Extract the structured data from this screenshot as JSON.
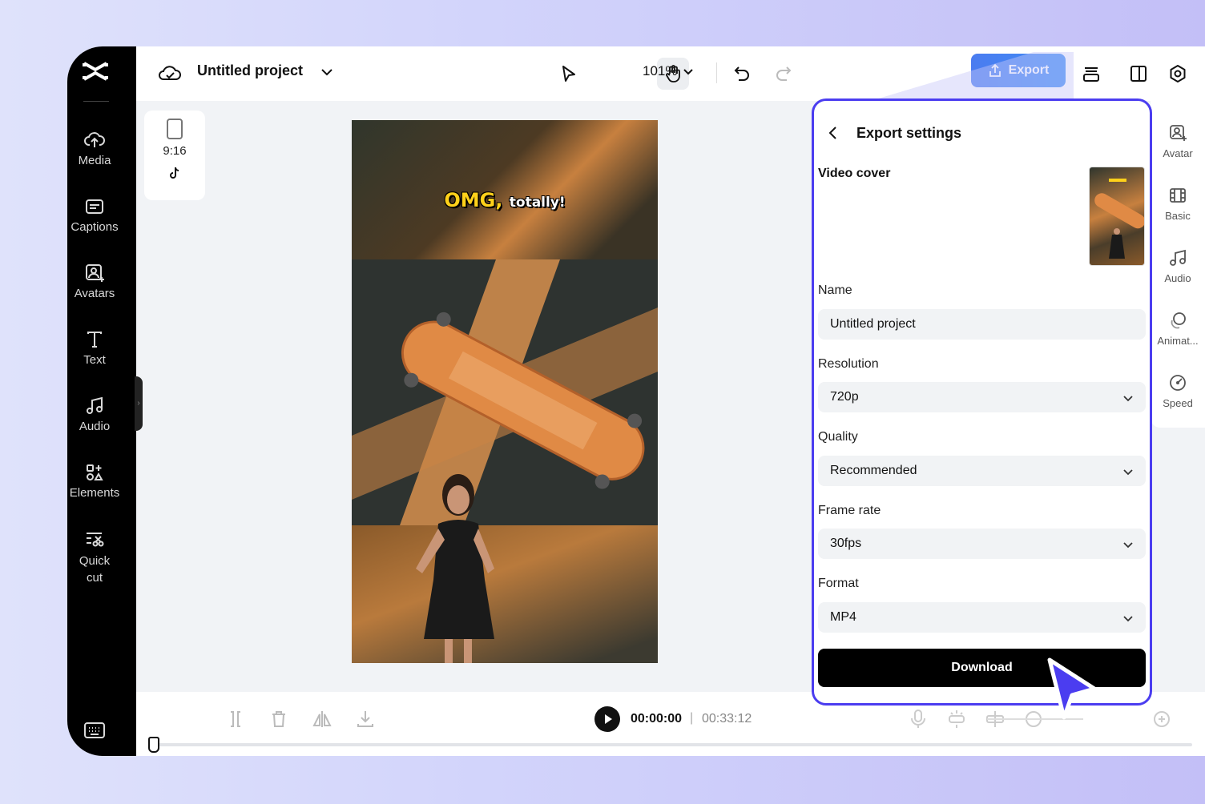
{
  "header": {
    "project_title": "Untitled project",
    "zoom": "101%",
    "export_label": "Export"
  },
  "sidebar": {
    "items": [
      {
        "label": "Media",
        "icon": "cloud-upload-icon"
      },
      {
        "label": "Captions",
        "icon": "captions-icon"
      },
      {
        "label": "Avatars",
        "icon": "avatar-icon"
      },
      {
        "label": "Text",
        "icon": "text-icon"
      },
      {
        "label": "Audio",
        "icon": "music-note-icon"
      },
      {
        "label": "Elements",
        "icon": "elements-icon"
      },
      {
        "label": "Quick cut",
        "icon": "quick-cut-icon"
      }
    ]
  },
  "canvas": {
    "ratio": "9:16",
    "caption_big": "OMG,",
    "caption_small": "totally!"
  },
  "right_rail": {
    "items": [
      {
        "label": "Avatar",
        "icon": "avatar-icon"
      },
      {
        "label": "Basic",
        "icon": "film-icon"
      },
      {
        "label": "Audio",
        "icon": "music-note-icon"
      },
      {
        "label": "Animat...",
        "icon": "animation-icon"
      },
      {
        "label": "Speed",
        "icon": "speed-icon"
      }
    ]
  },
  "export_panel": {
    "title": "Export settings",
    "video_cover_label": "Video cover",
    "name_label": "Name",
    "name_value": "Untitled project",
    "resolution_label": "Resolution",
    "resolution_value": "720p",
    "quality_label": "Quality",
    "quality_value": "Recommended",
    "framerate_label": "Frame rate",
    "framerate_value": "30fps",
    "format_label": "Format",
    "format_value": "MP4",
    "download_label": "Download"
  },
  "timeline": {
    "current_time": "00:00:00",
    "separator": "|",
    "total_time": "00:33:12"
  },
  "colors": {
    "accent": "#4b3df0",
    "export_button": "#4b7cf0",
    "sidebar_bg": "#000000"
  }
}
